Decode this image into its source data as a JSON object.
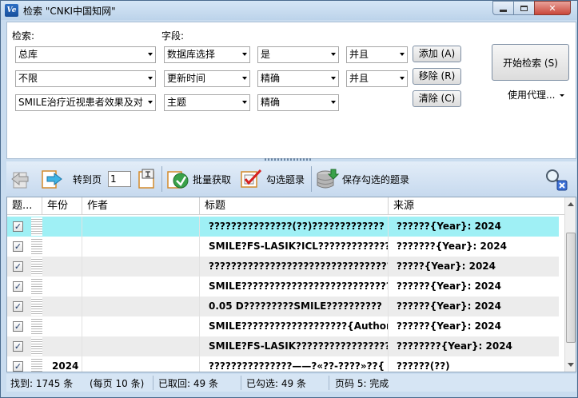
{
  "window": {
    "title": "检索 \"CNKI中国知网\"",
    "app_icon_text": "Ve"
  },
  "search": {
    "label_query": "检索:",
    "label_field": "字段:",
    "rows": [
      {
        "query": "总库",
        "field": "数据库选择",
        "value": "是",
        "logic": "并且"
      },
      {
        "query": "不限",
        "field": "更新时间",
        "value": "精确",
        "logic": "并且"
      },
      {
        "query": "SMILE治疗近视患者效果及对",
        "field": "主题",
        "value": "精确"
      }
    ],
    "add_label": "添加 (A)",
    "remove_label": "移除 (R)",
    "clear_label": "清除 (C)",
    "start_label": "开始检索 (S)",
    "proxy_label": "使用代理..."
  },
  "toolbar": {
    "goto_label": "转到页",
    "page_value": "1",
    "batch_label": "批量获取",
    "check_label": "勾选题录",
    "save_label": "保存勾选的题录"
  },
  "grid": {
    "headers": {
      "sel": "题...",
      "year": "年份",
      "author": "作者",
      "title": "标题",
      "source": "来源"
    },
    "rows": [
      {
        "checked": "✓",
        "year": "",
        "author": "",
        "title": "???????????????(??)?????????????",
        "source": "??????{Year}: 2024"
      },
      {
        "checked": "✓",
        "year": "",
        "author": "",
        "title": "SMILE?FS-LASIK?ICL?????????????",
        "source": "???????{Year}: 2024"
      },
      {
        "checked": "✓",
        "year": "",
        "author": "",
        "title": "?????????????????????????????????",
        "source": "?????{Year}: 2024"
      },
      {
        "checked": "✓",
        "year": "",
        "author": "",
        "title": "SMILE????????????????????????????",
        "source": "??????{Year}: 2024"
      },
      {
        "checked": "✓",
        "year": "",
        "author": "",
        "title": "0.05 D?????????SMILE??????????",
        "source": "??????{Year}: 2024"
      },
      {
        "checked": "✓",
        "year": "",
        "author": "",
        "title": "SMILE???????????????????{Author",
        "source": "??????{Year}: 2024"
      },
      {
        "checked": "✓",
        "year": "",
        "author": "",
        "title": "SMILE?FS-LASIK?????????????????",
        "source": "????????{Year}: 2024"
      },
      {
        "checked": "✓",
        "year": "2024",
        "author": "",
        "title": "???????????????——?«??-????»??{",
        "source": "??????(??)"
      }
    ]
  },
  "status": {
    "found": "找到: 1745 条",
    "per_page": "(每页 10 条)",
    "fetched": "已取回: 49 条",
    "checked": "已勾选: 49 条",
    "page_status": "页码 5: 完成"
  },
  "colors": {
    "selected_row": "#9ff0f5",
    "alt_row": "#ececec",
    "window_bg": "#c9dcef"
  }
}
